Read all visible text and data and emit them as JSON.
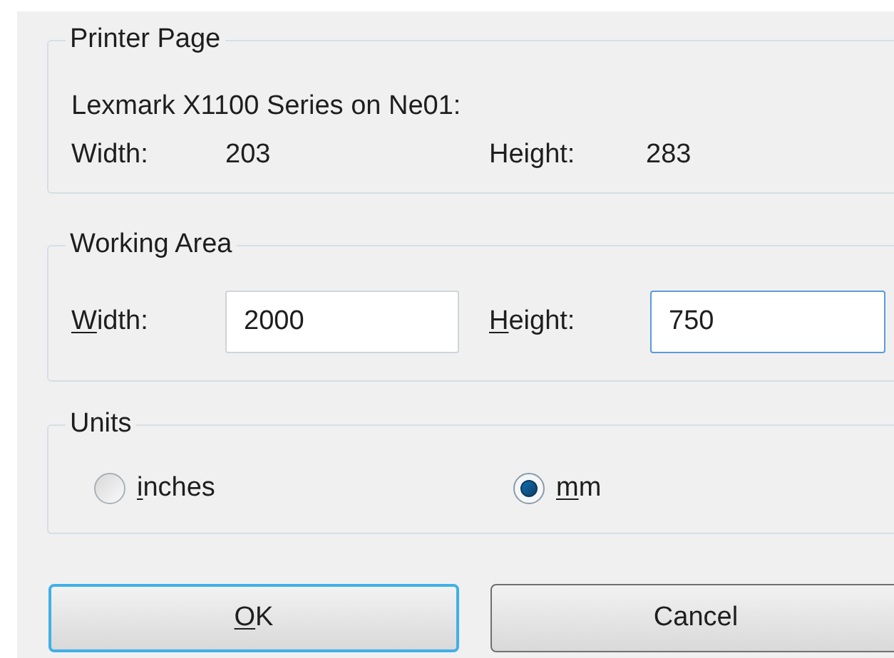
{
  "printer_page": {
    "title": "Printer Page",
    "printer": "Lexmark X1100 Series on Ne01:",
    "width_label": "Width:",
    "width_value": "203",
    "height_label": "Height:",
    "height_value": "283"
  },
  "working_area": {
    "title": "Working Area",
    "width_label": {
      "text": "Width:",
      "mnemonic": true
    },
    "width_value": "2000",
    "width_focused": false,
    "height_label": {
      "text": "Height:",
      "mnemonic": true
    },
    "height_value": "750",
    "height_focused": true
  },
  "units": {
    "title": "Units",
    "options": [
      {
        "label": "inches",
        "mnemonic": true,
        "selected": false
      },
      {
        "label": "mm",
        "mnemonic": true,
        "selected": true
      }
    ]
  },
  "buttons": [
    {
      "label": "OK",
      "mnemonic": true,
      "default": true
    },
    {
      "label": "Cancel",
      "mnemonic": false,
      "default": false
    }
  ]
}
